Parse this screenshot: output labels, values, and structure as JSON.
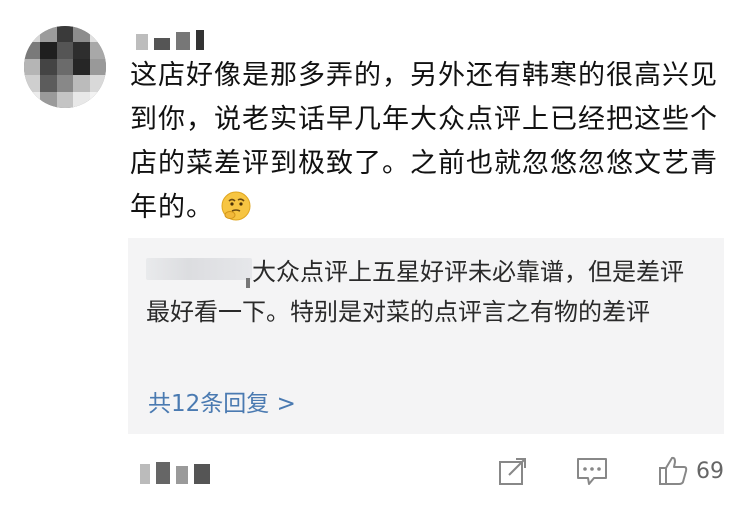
{
  "comment": {
    "text": "这店好像是那多弄的，另外还有韩寒的很高兴见到你，说老实话早几年大众点评上已经把这些个店的菜差评到极致了。之前也就忽悠忽悠文艺青年的。",
    "emoji": "thinking-emoji"
  },
  "reply": {
    "text": "大众点评上五星好评未必靠谱，但是差评最好看一下。特别是对菜的点评言之有物的差评",
    "more_label": "共12条回复 >"
  },
  "actions": {
    "share_icon": "share-icon",
    "comment_icon": "comment-icon",
    "like_icon": "thumbs-up-icon",
    "like_count": "69"
  },
  "colors": {
    "link": "#4a7ab1",
    "reply_bg": "#f4f4f5",
    "icon": "#888888"
  }
}
